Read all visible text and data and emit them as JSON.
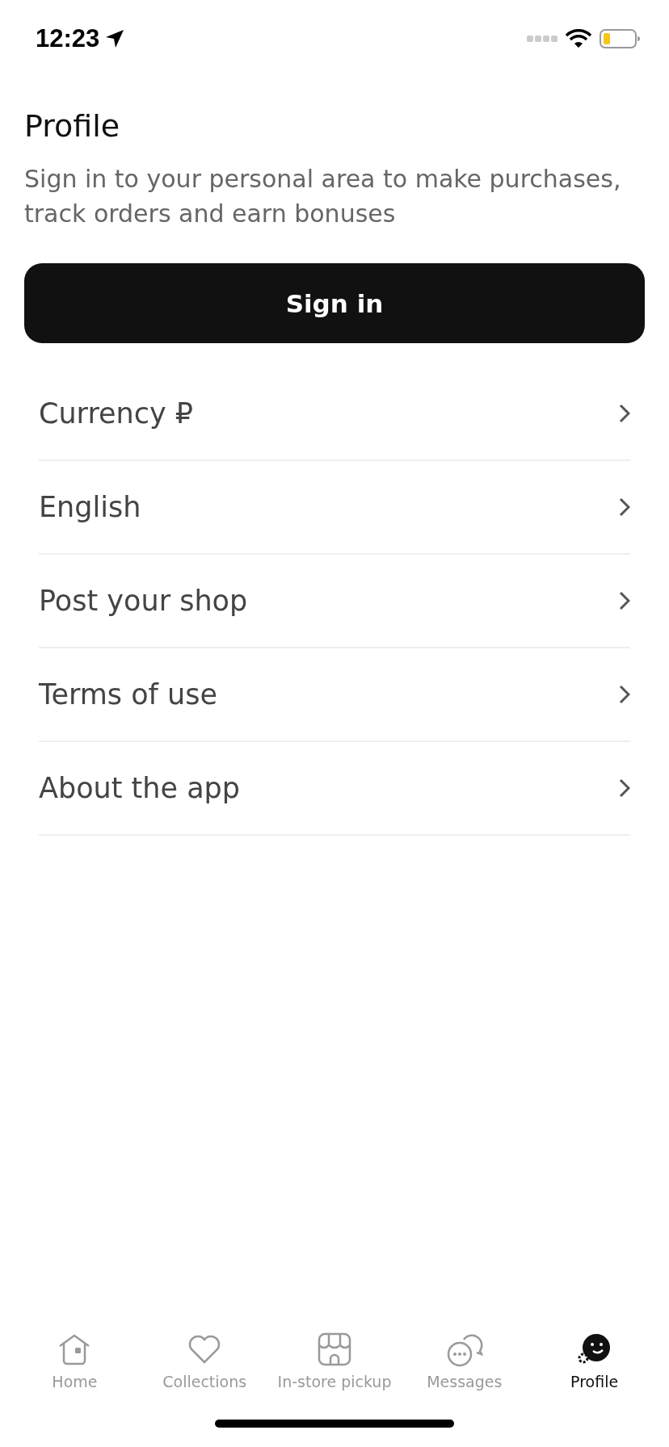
{
  "status_bar": {
    "time": "12:23"
  },
  "header": {
    "title": "Profile",
    "subtitle": "Sign in to your personal area to make purchases, track orders and earn bonuses"
  },
  "sign_in_button": "Sign in",
  "menu": [
    {
      "label": "Currency ₽"
    },
    {
      "label": "English"
    },
    {
      "label": "Post your shop"
    },
    {
      "label": "Terms of use"
    },
    {
      "label": "About the app"
    }
  ],
  "tab_bar": [
    {
      "label": "Home",
      "kind": "home",
      "selected": false
    },
    {
      "label": "Collections",
      "kind": "heart",
      "selected": false
    },
    {
      "label": "In-store pickup",
      "kind": "store",
      "selected": false
    },
    {
      "label": "Messages",
      "kind": "chat",
      "selected": false
    },
    {
      "label": "Profile",
      "kind": "profile",
      "selected": true
    }
  ]
}
